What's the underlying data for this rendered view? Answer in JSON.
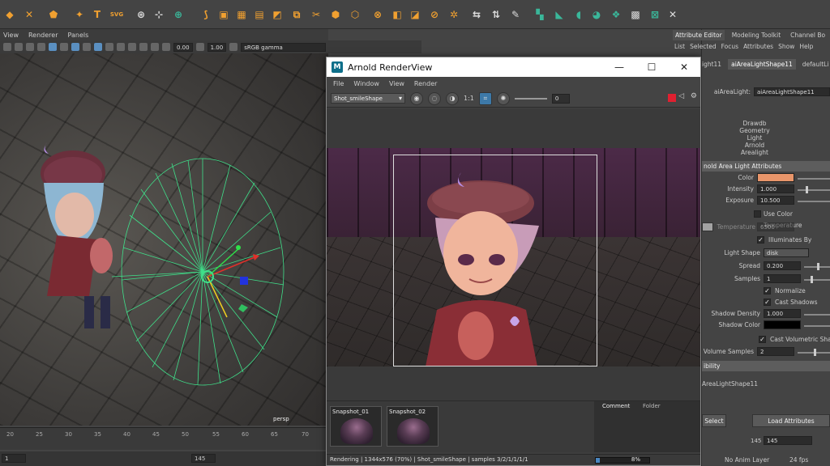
{
  "viewport": {
    "menus": [
      "View",
      "Renderer",
      "Panels"
    ],
    "camera_label": "persp",
    "exposure_value": "0.00",
    "gamma_value": "1.00",
    "color_space": "sRGB gamma"
  },
  "timeline": {
    "ticks": [
      "20",
      "25",
      "30",
      "35",
      "40",
      "45",
      "50",
      "55",
      "60",
      "65",
      "70"
    ],
    "range_start": "1",
    "range_end": "145"
  },
  "renderview": {
    "title": "Arnold RenderView",
    "logo": "M",
    "window_buttons": [
      "—",
      "☐",
      "✕"
    ],
    "menus": [
      "File",
      "Window",
      "View",
      "Render"
    ],
    "camera_select": "Shot_smileShape",
    "ratio_label": "1:1",
    "exposure_value": "0",
    "snapshots": [
      "Snapshot_01",
      "Snapshot_02"
    ],
    "tabs": [
      "Comment",
      "Folder"
    ],
    "status": "Rendering | 1344x576 (70%) | Shot_smileShape | samples 3/2/1/1/1/1",
    "progress_label": "8%",
    "progress_fraction": 0.08
  },
  "attribute_editor": {
    "top_tabs": [
      "Attribute Editor",
      "Modeling Toolkit",
      "Channel Bo"
    ],
    "menu": [
      "List",
      "Selected",
      "Focus",
      "Attributes",
      "Show",
      "Help"
    ],
    "node_tabs": [
      "ight11",
      "aiAreaLightShape11",
      "defaultLi"
    ],
    "node_label": "aiAreaLight:",
    "node_name": "aiAreaLightShape11",
    "node_types": [
      "Drawdb",
      "Geometry",
      "Light",
      "Arnold",
      "Arealight"
    ],
    "section_title": "nold Area Light Attributes",
    "color_label": "Color",
    "color_value": "#e8956a",
    "intensity_label": "Intensity",
    "intensity_value": "1.000",
    "exposure_label": "Exposure",
    "exposure_value": "10.500",
    "use_color_temp_label": "Use Color Temperature",
    "temperature_label": "Temperature",
    "temperature_value": "6500",
    "illuminates_label": "Illuminates By Default",
    "light_shape_label": "Light Shape",
    "light_shape_value": "disk",
    "spread_label": "Spread",
    "spread_value": "0.200",
    "samples_label": "Samples",
    "samples_value": "1",
    "normalize_label": "Normalize",
    "cast_shadows_label": "Cast Shadows",
    "shadow_density_label": "Shadow Density",
    "shadow_density_value": "1.000",
    "shadow_color_label": "Shadow Color",
    "cast_volumetric_label": "Cast Volumetric Shado",
    "volume_samples_label": "Volume Samples",
    "volume_samples_value": "2",
    "visibility_section": "ibility",
    "bottom_section": "AreaLightShape11",
    "select_button": "Select",
    "load_button": "Load Attributes",
    "frame_small": "145",
    "frame_field": "145",
    "anim_layer": "No Anim Layer",
    "fps": "24 fps"
  }
}
